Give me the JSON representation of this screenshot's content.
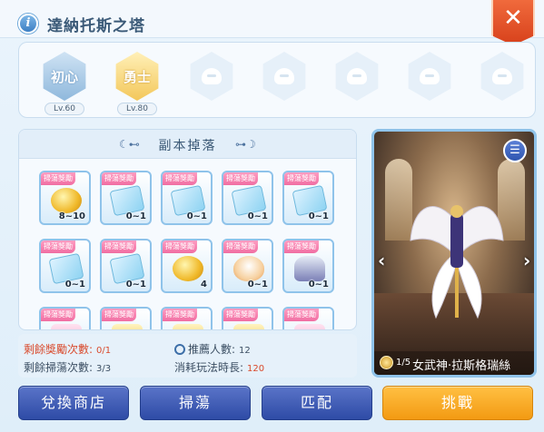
{
  "header": {
    "title": "達納托斯之塔",
    "close_label": "✕"
  },
  "difficulties": [
    {
      "label": "初心",
      "level": "Lv.60",
      "style": "blue"
    },
    {
      "label": "勇士",
      "level": "Lv.80",
      "style": "gold"
    },
    {
      "label": "",
      "level": "",
      "style": "locked"
    },
    {
      "label": "",
      "level": "",
      "style": "locked"
    },
    {
      "label": "",
      "level": "",
      "style": "locked"
    },
    {
      "label": "",
      "level": "",
      "style": "locked"
    },
    {
      "label": "",
      "level": "",
      "style": "locked"
    }
  ],
  "drops": {
    "title": "副本掉落",
    "tag": "掃蕩獎勵",
    "items": [
      {
        "art": "coin",
        "qty": "8~10"
      },
      {
        "art": "ticket",
        "qty": "0~1"
      },
      {
        "art": "ticket",
        "qty": "0~1"
      },
      {
        "art": "ticket",
        "qty": "0~1"
      },
      {
        "art": "ticket",
        "qty": "0~1"
      },
      {
        "art": "ticket",
        "qty": "0~1"
      },
      {
        "art": "ticket",
        "qty": "0~1"
      },
      {
        "art": "coin",
        "qty": "4"
      },
      {
        "art": "egg",
        "qty": "0~1"
      },
      {
        "art": "helm",
        "qty": "0~1"
      },
      {
        "art": "pink",
        "qty": ""
      },
      {
        "art": "gold",
        "qty": ""
      },
      {
        "art": "gold",
        "qty": ""
      },
      {
        "art": "gold",
        "qty": ""
      },
      {
        "art": "pink",
        "qty": ""
      }
    ]
  },
  "stats": {
    "remaining_rewards_label": "剩餘獎勵次數:",
    "remaining_rewards_value": "0/1",
    "remaining_sweeps_label": "剩餘掃蕩次數:",
    "remaining_sweeps_value": "3/3",
    "recommended_label": "推薦人數:",
    "recommended_value": "12",
    "duration_label": "消耗玩法時長:",
    "duration_value": "120"
  },
  "boss": {
    "page": "1/5",
    "name": "女武神·拉斯格瑞絲"
  },
  "buttons": {
    "shop": "兌換商店",
    "sweep": "掃蕩",
    "match": "匹配",
    "challenge": "挑戰"
  },
  "colors": {
    "accent": "#2e4ba6",
    "challenge": "#f39a12",
    "close": "#e0512a",
    "warning": "#d94a2c"
  }
}
